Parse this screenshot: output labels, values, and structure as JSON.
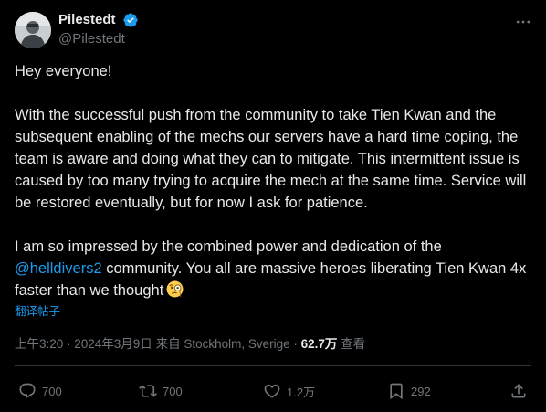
{
  "author": {
    "name": "Pilestedt",
    "handle": "@Pilestedt",
    "verified_color": "#1d9bf0"
  },
  "tweet": {
    "greeting": "Hey everyone!",
    "paragraph2": "With the successful push from the community to take Tien Kwan and the subsequent enabling of the mechs our servers have a hard time coping, the team is aware and doing what they can to mitigate. This intermittent issue is caused by too many trying to acquire the mech at the same time. Service will be restored eventually, but for now I ask for patience.",
    "paragraph3_intro": "I am so impressed by the combined power and dedication of the",
    "mention": "@helldivers2",
    "paragraph3_rest": " community. You all are massive heroes liberating Tien Kwan 4x faster than we thought",
    "emoji": "face-with-monocle"
  },
  "translate_link": "翻译帖子",
  "meta": {
    "time_and_place": "上午3:20 · 2024年3月9日 来自 Stockholm, Sverige · ",
    "views_count": "62.7万",
    "views_label": " 查看"
  },
  "actions": {
    "replies": "700",
    "reposts": "700",
    "likes": "1.2万",
    "bookmarks": "292"
  },
  "colors": {
    "background": "#000000",
    "text": "#e7e9ea",
    "secondary": "#71767b",
    "accent": "#1d9bf0"
  }
}
